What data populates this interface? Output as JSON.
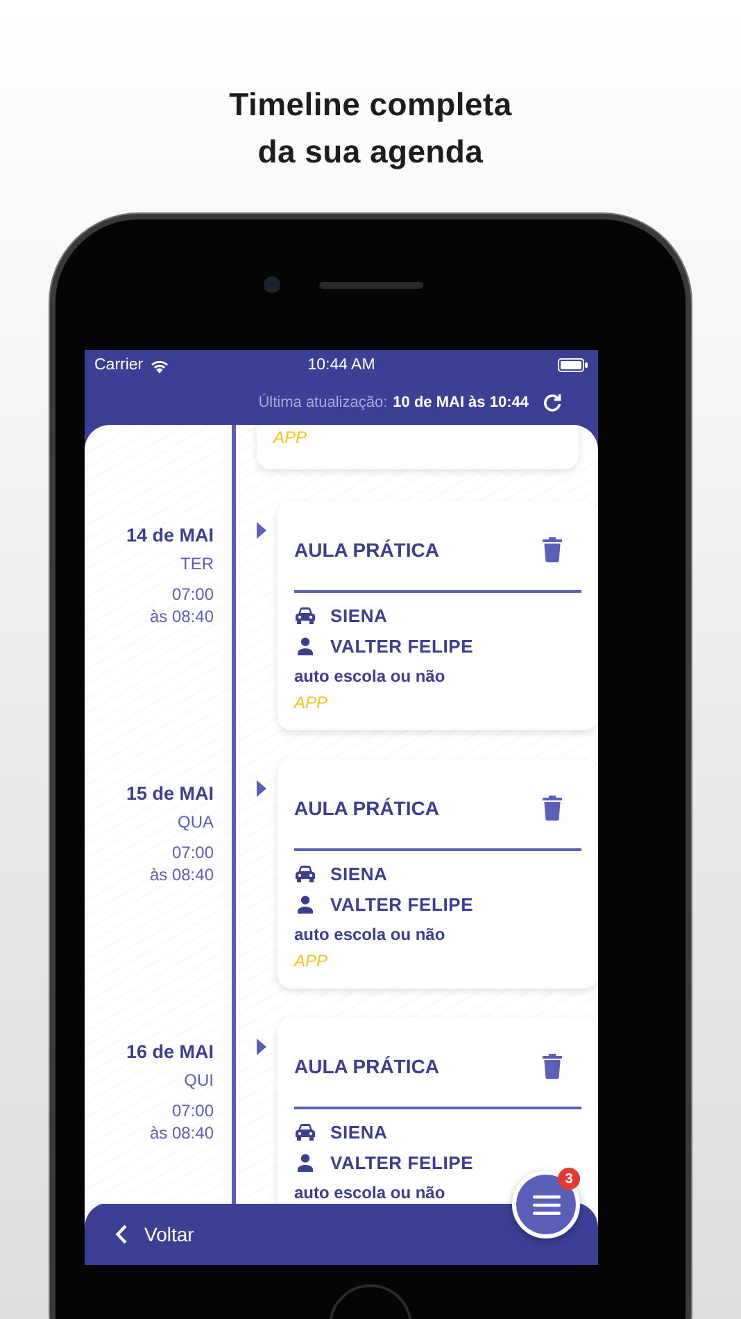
{
  "headline": "Timeline completa\nda sua agenda",
  "status_bar": {
    "carrier": "Carrier",
    "time": "10:44 AM"
  },
  "update": {
    "label": "Última atualização:",
    "value": "10 de MAI às 10:44"
  },
  "timeline": [
    {
      "kind": "partial",
      "source": "APP"
    },
    {
      "kind": "full",
      "date": "14 de MAI",
      "weekday": "TER",
      "start": "07:00",
      "end": "às 08:40",
      "title": "AULA PRÁTICA",
      "car": "SIENA",
      "instructor": "VALTER FELIPE",
      "school": "auto escola ou não",
      "source": "APP"
    },
    {
      "kind": "full",
      "date": "15 de MAI",
      "weekday": "QUA",
      "start": "07:00",
      "end": "às 08:40",
      "title": "AULA PRÁTICA",
      "car": "SIENA",
      "instructor": "VALTER FELIPE",
      "school": "auto escola ou não",
      "source": "APP"
    },
    {
      "kind": "full",
      "date": "16 de MAI",
      "weekday": "QUI",
      "start": "07:00",
      "end": "às 08:40",
      "title": "AULA PRÁTICA",
      "car": "SIENA",
      "instructor": "VALTER FELIPE",
      "school": "auto escola ou não"
    }
  ],
  "menu_button": {
    "badge": "3"
  },
  "bottom_bar": {
    "back": "Voltar"
  }
}
